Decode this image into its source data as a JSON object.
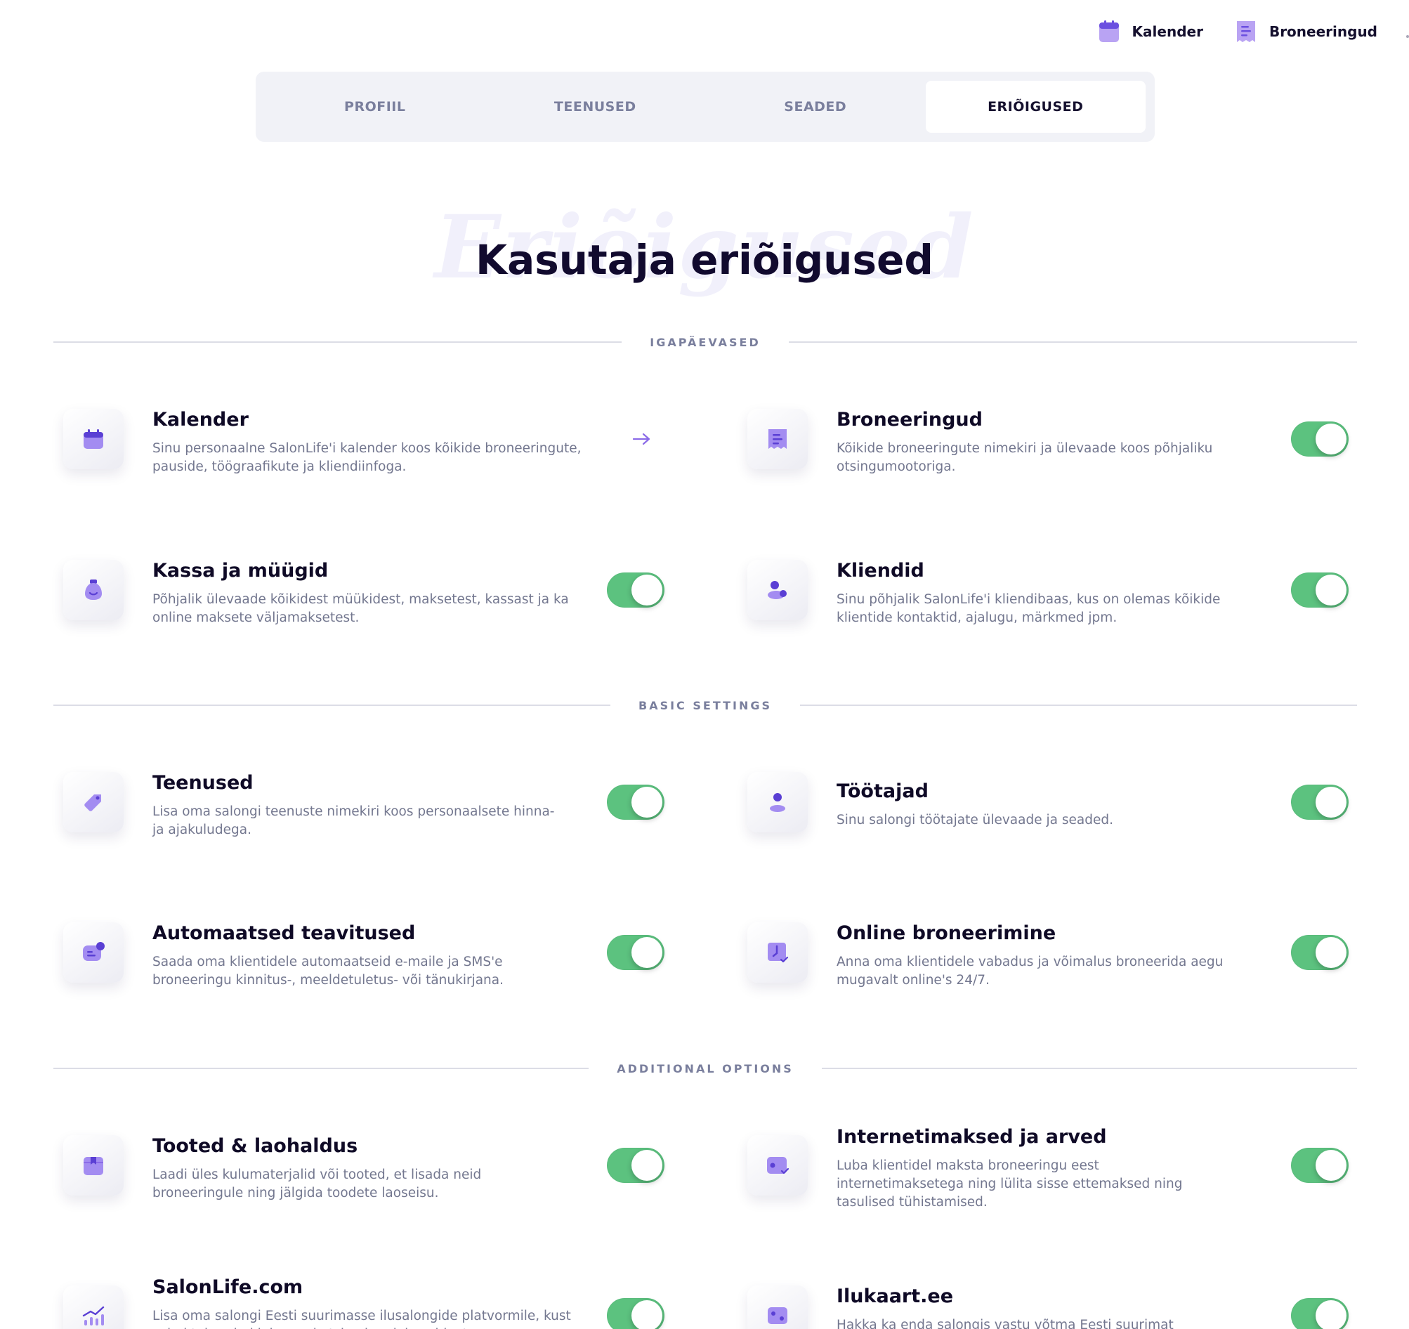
{
  "topnav": {
    "items": [
      {
        "label": "Kalender",
        "icon": "calendar-icon"
      },
      {
        "label": "Broneeringud",
        "icon": "receipt-icon"
      }
    ]
  },
  "tabs": [
    {
      "label": "PROFIIL",
      "active": false
    },
    {
      "label": "TEENUSED",
      "active": false
    },
    {
      "label": "SEADED",
      "active": false
    },
    {
      "label": "ERIÕIGUSED",
      "active": true
    }
  ],
  "page": {
    "watermark": "Eriõigused",
    "title": "Kasutaja eriõigused"
  },
  "sections": [
    {
      "label": "IGAPÄEVASED"
    },
    {
      "label": "BASIC SETTINGS"
    },
    {
      "label": "ADDITIONAL OPTIONS"
    }
  ],
  "permissions": [
    {
      "title": "Kalender",
      "description": "Sinu personaalne SalonLife'i kalender koos kõikide broneeringute, pauside, töögraafikute ja kliendiinfoga.",
      "icon": "calendar-icon",
      "control": "arrow"
    },
    {
      "title": "Broneeringud",
      "description": "Kõikide broneeringute nimekiri ja ülevaade koos põhjaliku otsingumootoriga.",
      "icon": "receipt-icon",
      "control": "toggle",
      "enabled": true
    },
    {
      "title": "Kassa ja müügid",
      "description": "Põhjalik ülevaade kõikidest müükidest, maksetest, kassast ja ka online maksete väljamaksetest.",
      "icon": "money-bag-icon",
      "control": "toggle",
      "enabled": true
    },
    {
      "title": "Kliendid",
      "description": "Sinu põhjalik SalonLife'i kliendibaas, kus on olemas kõikide klientide kontaktid, ajalugu, märkmed jpm.",
      "icon": "clients-icon",
      "control": "toggle",
      "enabled": true
    },
    {
      "title": "Teenused",
      "description": "Lisa oma salongi teenuste nimekiri koos personaalsete hinna- ja ajakuludega.",
      "icon": "price-tag-icon",
      "control": "toggle",
      "enabled": true
    },
    {
      "title": "Töötajad",
      "description": "Sinu salongi töötajate ülevaade ja seaded.",
      "icon": "user-icon",
      "control": "toggle",
      "enabled": true
    },
    {
      "title": "Automaatsed teavitused",
      "description": "Saada oma klientidele automaatseid e-maile ja SMS'e broneeringu kinnitus-, meeldetuletus- või tänukirjana.",
      "icon": "notification-chat-icon",
      "control": "toggle",
      "enabled": true
    },
    {
      "title": "Online broneerimine",
      "description": "Anna oma klientidele vabadus ja võimalus broneerida aegu mugavalt online's 24/7.",
      "icon": "online-booking-icon",
      "control": "toggle",
      "enabled": true
    },
    {
      "title": "Tooted & laohaldus",
      "description": "Laadi üles kulumaterjalid või tooted, et lisada neid broneeringule ning jälgida toodete laoseisu.",
      "icon": "product-box-icon",
      "control": "toggle",
      "enabled": true
    },
    {
      "title": "Internetimaksed ja arved",
      "description": "Luba klientidel maksta broneeringu eest internetimaksetega ning lülita sisse ettemaksed ning tasulised tühistamised.",
      "icon": "card-payment-icon",
      "control": "toggle",
      "enabled": true
    },
    {
      "title": "SalonLife.com",
      "description": "Lisa oma salongi Eesti suurimasse ilusalongide platvormile, kust sajad tuhanded inimesed otsivad endale sobivat",
      "icon": "growth-chart-icon",
      "control": "toggle",
      "enabled": true
    },
    {
      "title": "Ilukaart.ee",
      "description": "Hakka ka enda salongis vastu võtma Eesti suurimat",
      "icon": "gift-card-icon",
      "control": "toggle",
      "enabled": true
    }
  ],
  "colors": {
    "accent": "#8b6be8",
    "accent_dark": "#5a3fd4",
    "toggle_on": "#5cc27f",
    "title": "#110a2e",
    "muted": "#7a7f9d"
  }
}
